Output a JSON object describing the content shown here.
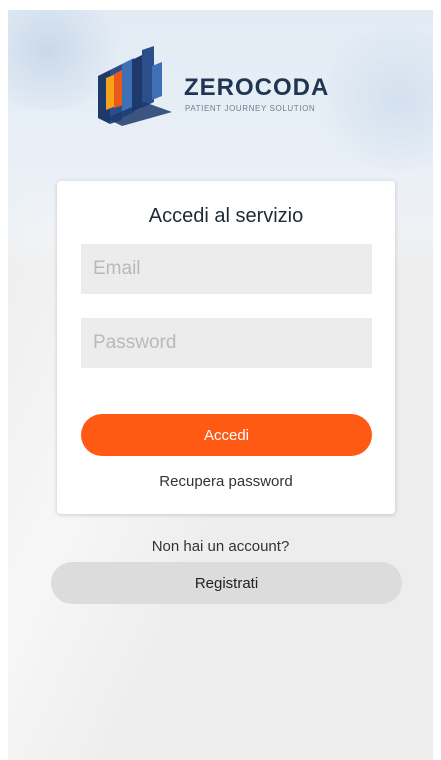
{
  "brand": {
    "name": "ZEROCODA",
    "tagline": "PATIENT JOURNEY SOLUTION",
    "logo_colors": [
      "#f7a21b",
      "#e8591a",
      "#2c4f8c",
      "#1d3a6b",
      "#3f6fb5"
    ]
  },
  "login": {
    "title": "Accedi al servizio",
    "email_placeholder": "Email",
    "password_placeholder": "Password",
    "submit_label": "Accedi",
    "recover_label": "Recupera password"
  },
  "signup": {
    "prompt": "Non hai un account?",
    "button_label": "Registrati"
  },
  "colors": {
    "accent": "#ff5a14",
    "secondary_button": "#dcdcdc",
    "field_background": "#ececec"
  }
}
